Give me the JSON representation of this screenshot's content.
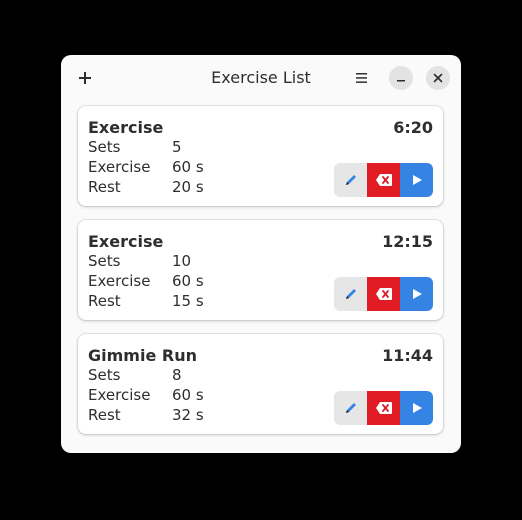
{
  "window": {
    "title": "Exercise List",
    "add_icon": "plus-icon",
    "menu_icon": "hamburger-menu-icon",
    "minimize_icon": "minimize-icon",
    "close_icon": "close-icon"
  },
  "labels": {
    "sets": "Sets",
    "exercise": "Exercise",
    "rest": "Rest"
  },
  "colors": {
    "delete": "#e01b24",
    "start": "#3584e4",
    "edit_bg": "#e6e6e6"
  },
  "cards": [
    {
      "name": "Exercise",
      "duration": "6:20",
      "sets": "5",
      "exercise": "60 s",
      "rest": "20 s"
    },
    {
      "name": "Exercise",
      "duration": "12:15",
      "sets": "10",
      "exercise": "60 s",
      "rest": "15 s"
    },
    {
      "name": "Gimmie Run",
      "duration": "11:44",
      "sets": "8",
      "exercise": "60 s",
      "rest": "32 s"
    }
  ]
}
